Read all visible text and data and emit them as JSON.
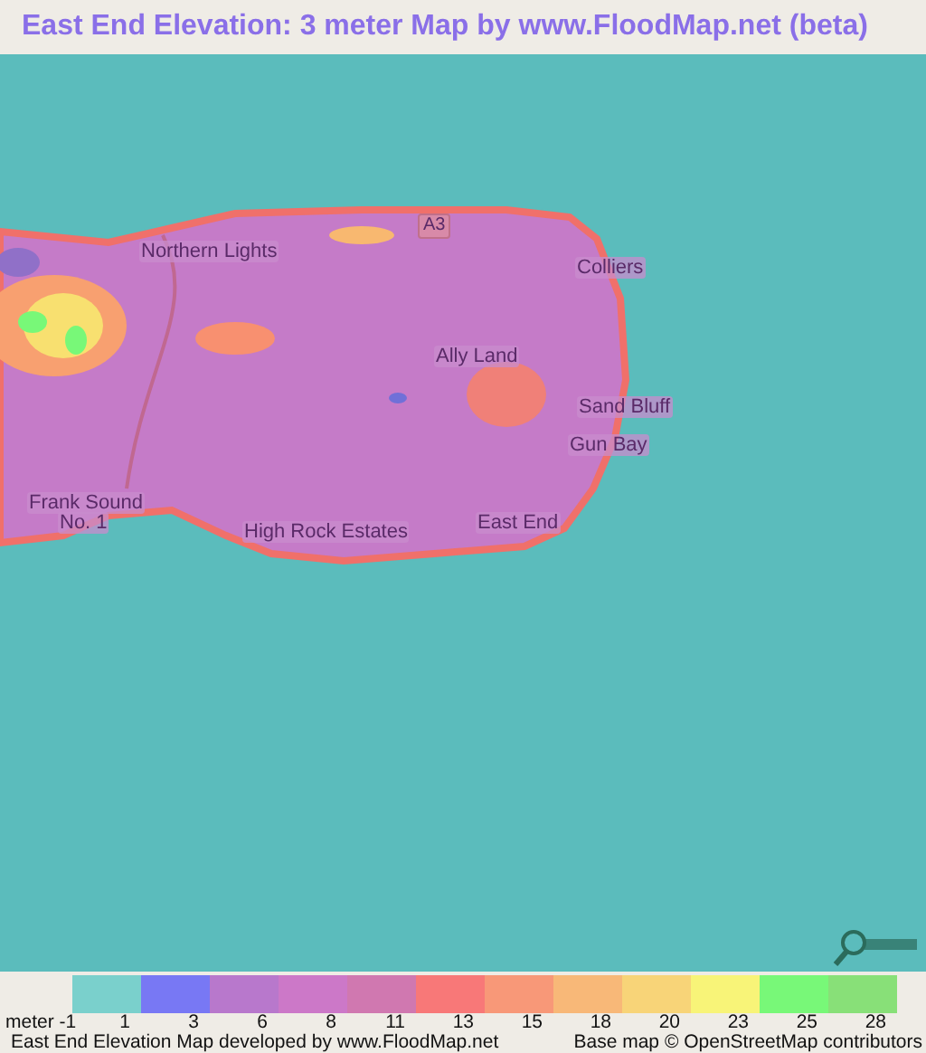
{
  "title": "East End Elevation: 3 meter Map by www.FloodMap.net (beta)",
  "map": {
    "labels": [
      {
        "kind": "road",
        "text": "A3"
      },
      {
        "kind": "place",
        "text": "Northern Lights"
      },
      {
        "kind": "place",
        "text": "Colliers"
      },
      {
        "kind": "place",
        "text": "Ally Land"
      },
      {
        "kind": "place",
        "text": "Sand Bluff"
      },
      {
        "kind": "place",
        "text": "Gun Bay"
      },
      {
        "kind": "place",
        "text": "Frank Sound"
      },
      {
        "kind": "place",
        "text": "No. 1"
      },
      {
        "kind": "place",
        "text": "High Rock Estates"
      },
      {
        "kind": "place",
        "text": "East End"
      }
    ]
  },
  "legend": {
    "unit_label": "meter -1",
    "entries": [
      {
        "color": "#7ad0cc",
        "label": "1"
      },
      {
        "color": "#7878f4",
        "label": "3"
      },
      {
        "color": "#b878cc",
        "label": "6"
      },
      {
        "color": "#cc78c8",
        "label": "8"
      },
      {
        "color": "#d078b0",
        "label": "11"
      },
      {
        "color": "#f87878",
        "label": "13"
      },
      {
        "color": "#f89878",
        "label": "15"
      },
      {
        "color": "#f8b878",
        "label": "18"
      },
      {
        "color": "#f8d478",
        "label": "20"
      },
      {
        "color": "#f8f478",
        "label": "23"
      },
      {
        "color": "#78f878",
        "label": "25"
      },
      {
        "color": "#88e078",
        "label": "28"
      }
    ]
  },
  "footer": {
    "left": "East End Elevation Map developed by www.FloodMap.net",
    "right": "Base map © OpenStreetMap contributors"
  }
}
